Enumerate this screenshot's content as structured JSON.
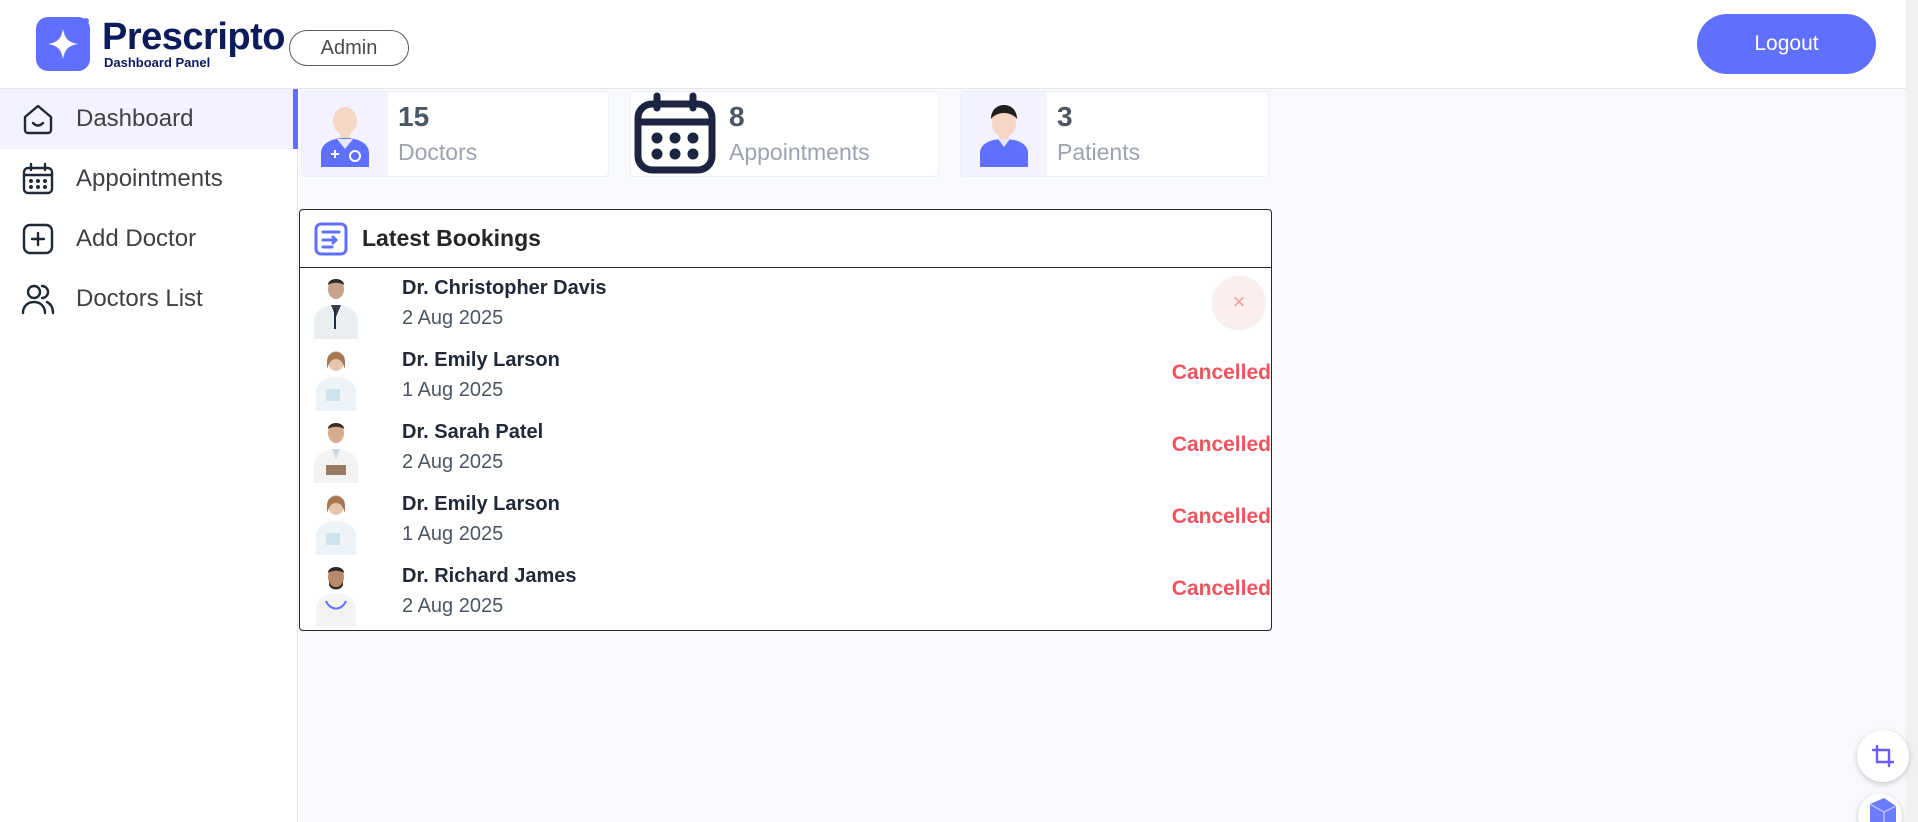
{
  "header": {
    "logo_title": "Prescripto",
    "logo_subtitle": "Dashboard Panel",
    "role_badge": "Admin",
    "logout_label": "Logout"
  },
  "sidebar": {
    "items": [
      {
        "label": "Dashboard",
        "icon": "home-icon",
        "active": true
      },
      {
        "label": "Appointments",
        "icon": "calendar-icon",
        "active": false
      },
      {
        "label": "Add Doctor",
        "icon": "add-icon",
        "active": false
      },
      {
        "label": "Doctors List",
        "icon": "people-icon",
        "active": false
      }
    ]
  },
  "stats": [
    {
      "count": "15",
      "label": "Doctors",
      "icon": "doctor-icon"
    },
    {
      "count": "8",
      "label": "Appointments",
      "icon": "calendar-icon"
    },
    {
      "count": "3",
      "label": "Patients",
      "icon": "patient-icon"
    }
  ],
  "latest_bookings": {
    "title": "Latest Bookings",
    "rows": [
      {
        "doctor": "Dr. Christopher Davis",
        "date": "2 Aug 2025",
        "status": "",
        "action": "×"
      },
      {
        "doctor": "Dr. Emily Larson",
        "date": "1 Aug 2025",
        "status": "Cancelled"
      },
      {
        "doctor": "Dr. Sarah Patel",
        "date": "2 Aug 2025",
        "status": "Cancelled"
      },
      {
        "doctor": "Dr. Emily Larson",
        "date": "1 Aug 2025",
        "status": "Cancelled"
      },
      {
        "doctor": "Dr. Richard James",
        "date": "2 Aug 2025",
        "status": "Cancelled"
      }
    ]
  },
  "colors": {
    "primary": "#5f6fff",
    "navy": "#0b1b5c",
    "cancelled": "#f0545e",
    "main_bg": "#f8f9fd"
  }
}
